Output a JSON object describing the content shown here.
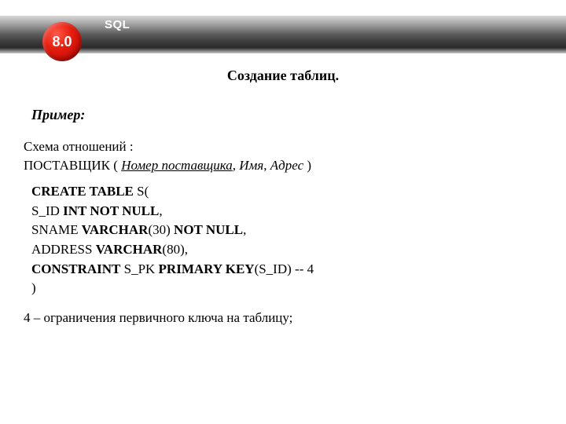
{
  "header": {
    "sql_label": "SQL",
    "badge": "8.0"
  },
  "title": "Создание таблиц.",
  "example_label": "Пример:",
  "schema": {
    "line1_prefix": "Схема отношений ",
    "line1_colon": ":",
    "relation_name": "ПОСТАВЩИК",
    "open": " ( ",
    "key_attr": "Номер поставщика",
    "sep1": ", ",
    "attr2": "Имя",
    "sep2": ", ",
    "attr3": "Адрес",
    "close": " )"
  },
  "sql": {
    "l1_kw": "CREATE TABLE",
    "l1_rest": " S(",
    "l2_col": "S_ID ",
    "l2_kw": "INT NOT NULL",
    "l2_end": ",",
    "l3_col": "SNAME ",
    "l3_kw1": "VARCHAR",
    "l3_mid": "(30) ",
    "l3_kw2": "NOT NULL",
    "l3_end": ",",
    "l4_col": "ADDRESS ",
    "l4_kw": "VARCHAR",
    "l4_end": "(80),",
    "l5_kw1": "CONSTRAINT",
    "l5_mid": " S_PK ",
    "l5_kw2": "PRIMARY KEY",
    "l5_end": "(S_ID) -- 4",
    "l6": ")"
  },
  "footnote": "4 – ограничения первичного ключа на таблицу;"
}
